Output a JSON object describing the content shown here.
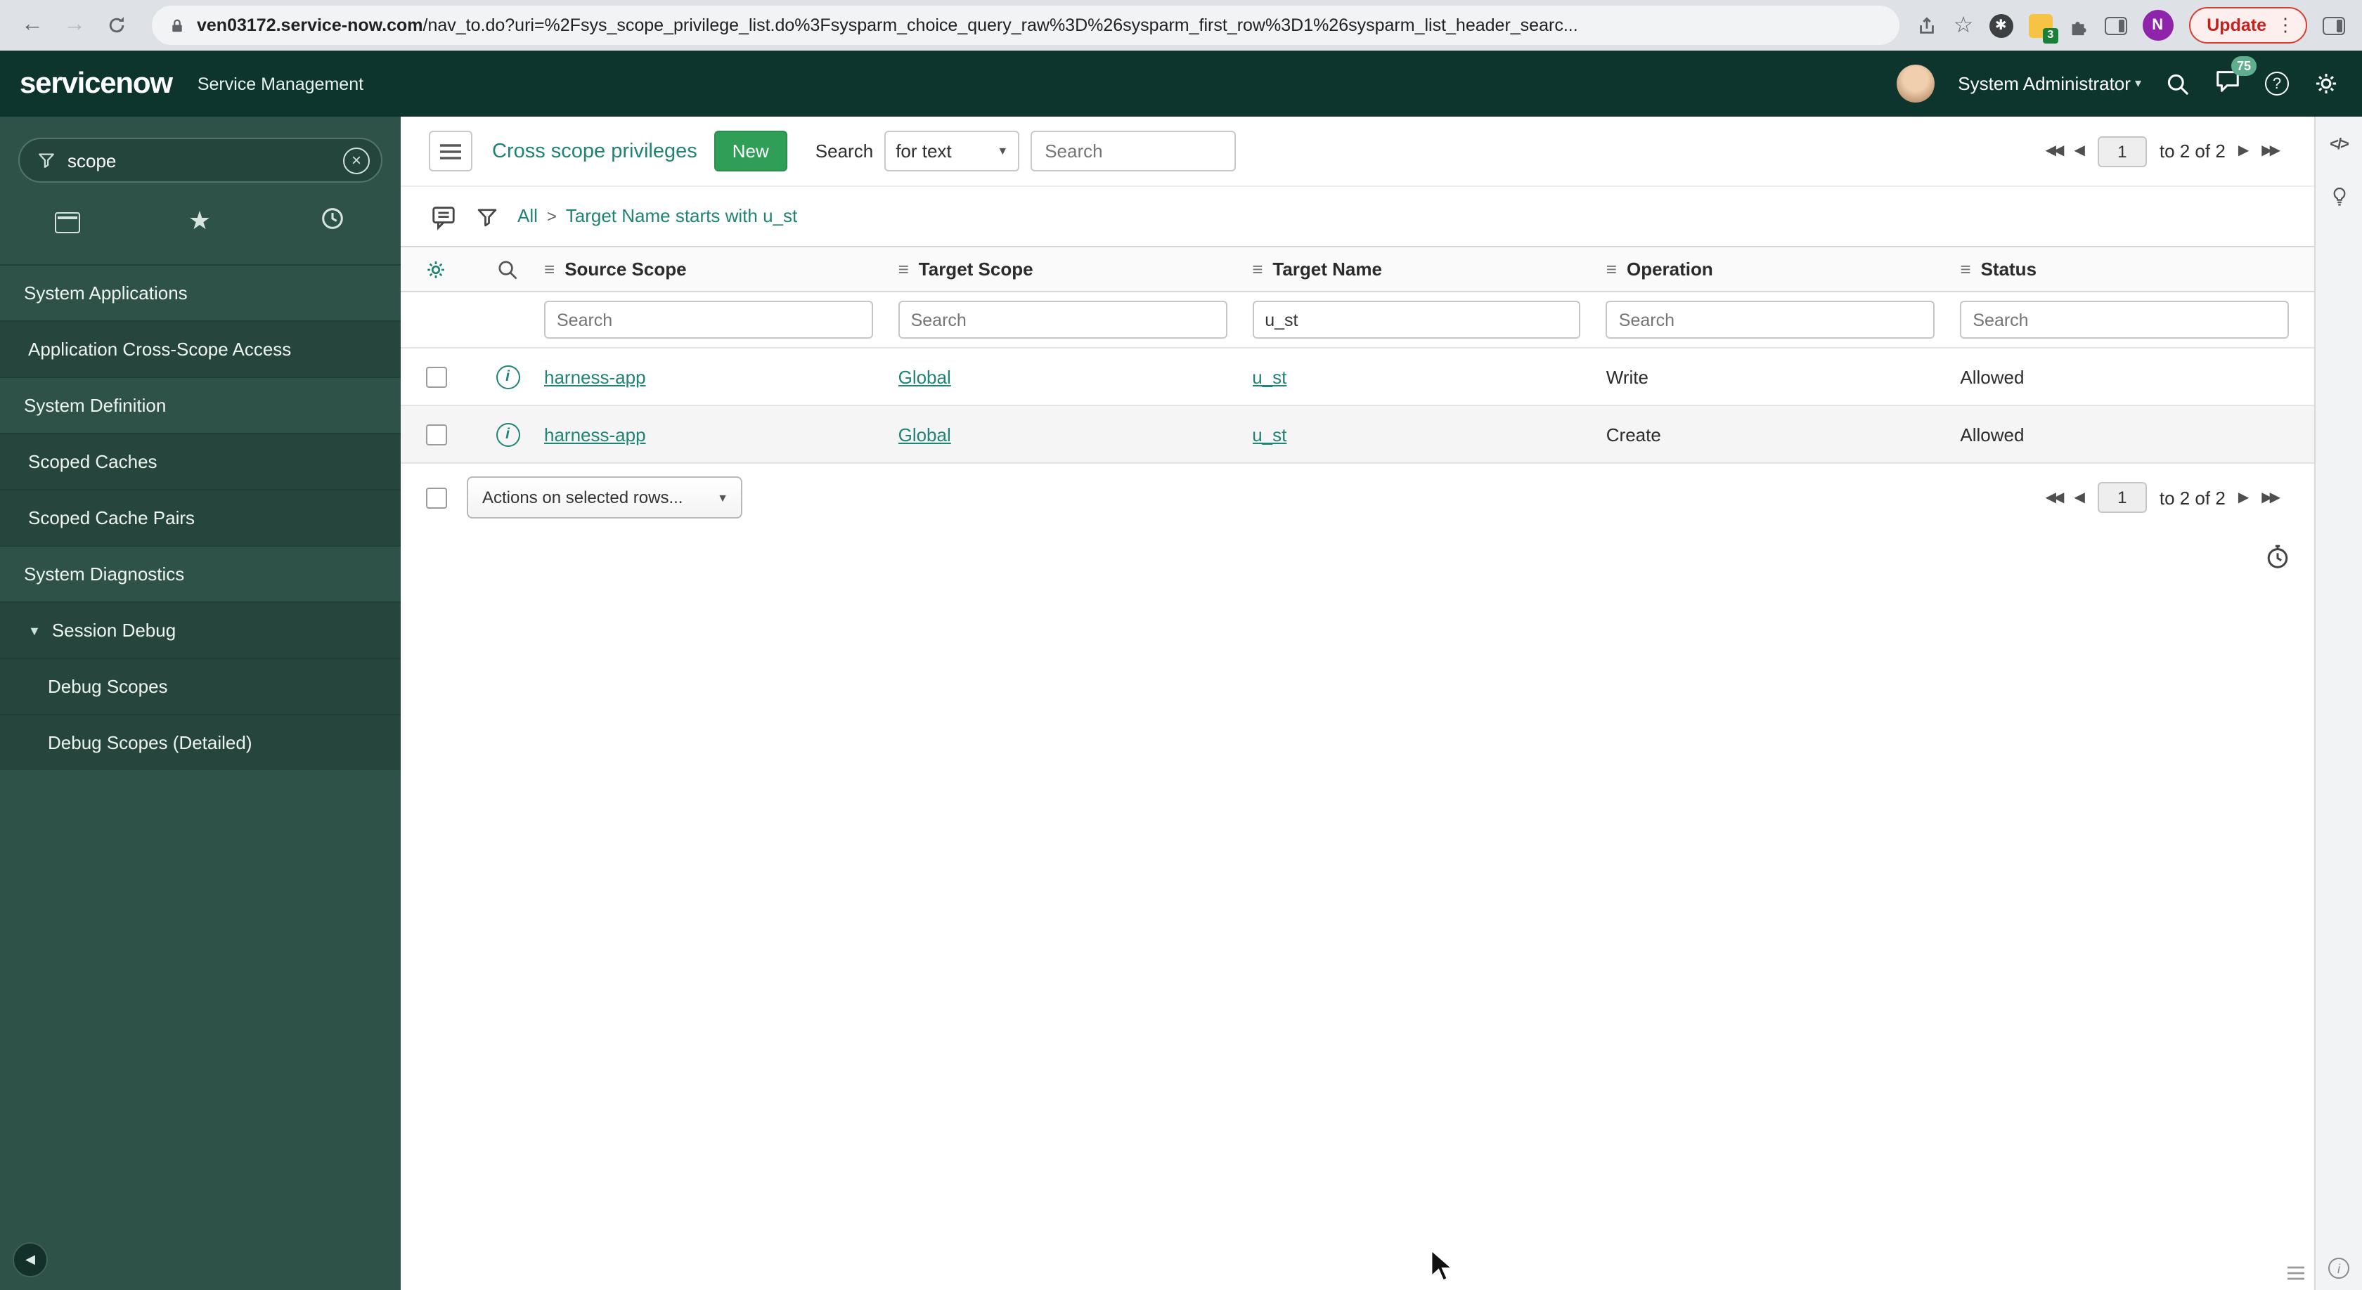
{
  "colors": {
    "header_bg": "#0d352d",
    "sidebar_bg": "#2f5248",
    "sidebar_item_bg": "#26453c",
    "accent_green": "#1f8476",
    "new_button_green": "#2f9e57",
    "update_red": "#c5221f",
    "notification_badge_green": "#5fae8e"
  },
  "icons": {
    "back": "←",
    "forward": "→",
    "star": "☆",
    "menu_dots": "⋮",
    "caret_down": "▾",
    "select_caret": "▼",
    "expand_caret": "▼",
    "pager_first": "◀◀",
    "pager_prev": "◀",
    "pager_next": "▶",
    "pager_last": "▶▶",
    "column_menu": "≡",
    "code": "</>",
    "collapse": "◀",
    "help": "?",
    "info": "i",
    "clear": "×"
  },
  "browser": {
    "url_domain": "ven03172.service-now.com",
    "url_path": "/nav_to.do?uri=%2Fsys_scope_privilege_list.do%3Fsysparm_choice_query_raw%3D%26sysparm_first_row%3D1%26sysparm_list_header_searc...",
    "update_label": "Update",
    "extension_badge": "3",
    "profile_initial": "N"
  },
  "app_header": {
    "logo": "servicenow",
    "product": "Service Management",
    "user_name": "System Administrator",
    "notification_count": "75"
  },
  "sidebar": {
    "filter_value": "scope",
    "items": [
      {
        "label": "System Applications"
      },
      {
        "label": "Application Cross-Scope Access"
      },
      {
        "label": "System Definition"
      },
      {
        "label": "Scoped Caches"
      },
      {
        "label": "Scoped Cache Pairs"
      },
      {
        "label": "System Diagnostics"
      },
      {
        "label": "Session Debug"
      },
      {
        "label": "Debug Scopes"
      },
      {
        "label": "Debug Scopes (Detailed)"
      }
    ]
  },
  "toolbar": {
    "title": "Cross scope privileges",
    "new_label": "New",
    "search_label": "Search",
    "search_type": "for text",
    "search_placeholder": "Search"
  },
  "breadcrumb": {
    "all": "All",
    "separator": ">",
    "condition": "Target Name starts with u_st"
  },
  "pagination": {
    "page": "1",
    "range_label": "to 2 of 2"
  },
  "table": {
    "columns": [
      "Source Scope",
      "Target Scope",
      "Target Name",
      "Operation",
      "Status"
    ],
    "search_placeholder": "Search",
    "search_values": {
      "target_name": "u_st"
    },
    "rows": [
      {
        "source_scope": "harness-app",
        "target_scope": "Global",
        "target_name": "u_st",
        "operation": "Write",
        "status": "Allowed"
      },
      {
        "source_scope": "harness-app",
        "target_scope": "Global",
        "target_name": "u_st",
        "operation": "Create",
        "status": "Allowed"
      }
    ]
  },
  "footer": {
    "actions_label": "Actions on selected rows..."
  }
}
